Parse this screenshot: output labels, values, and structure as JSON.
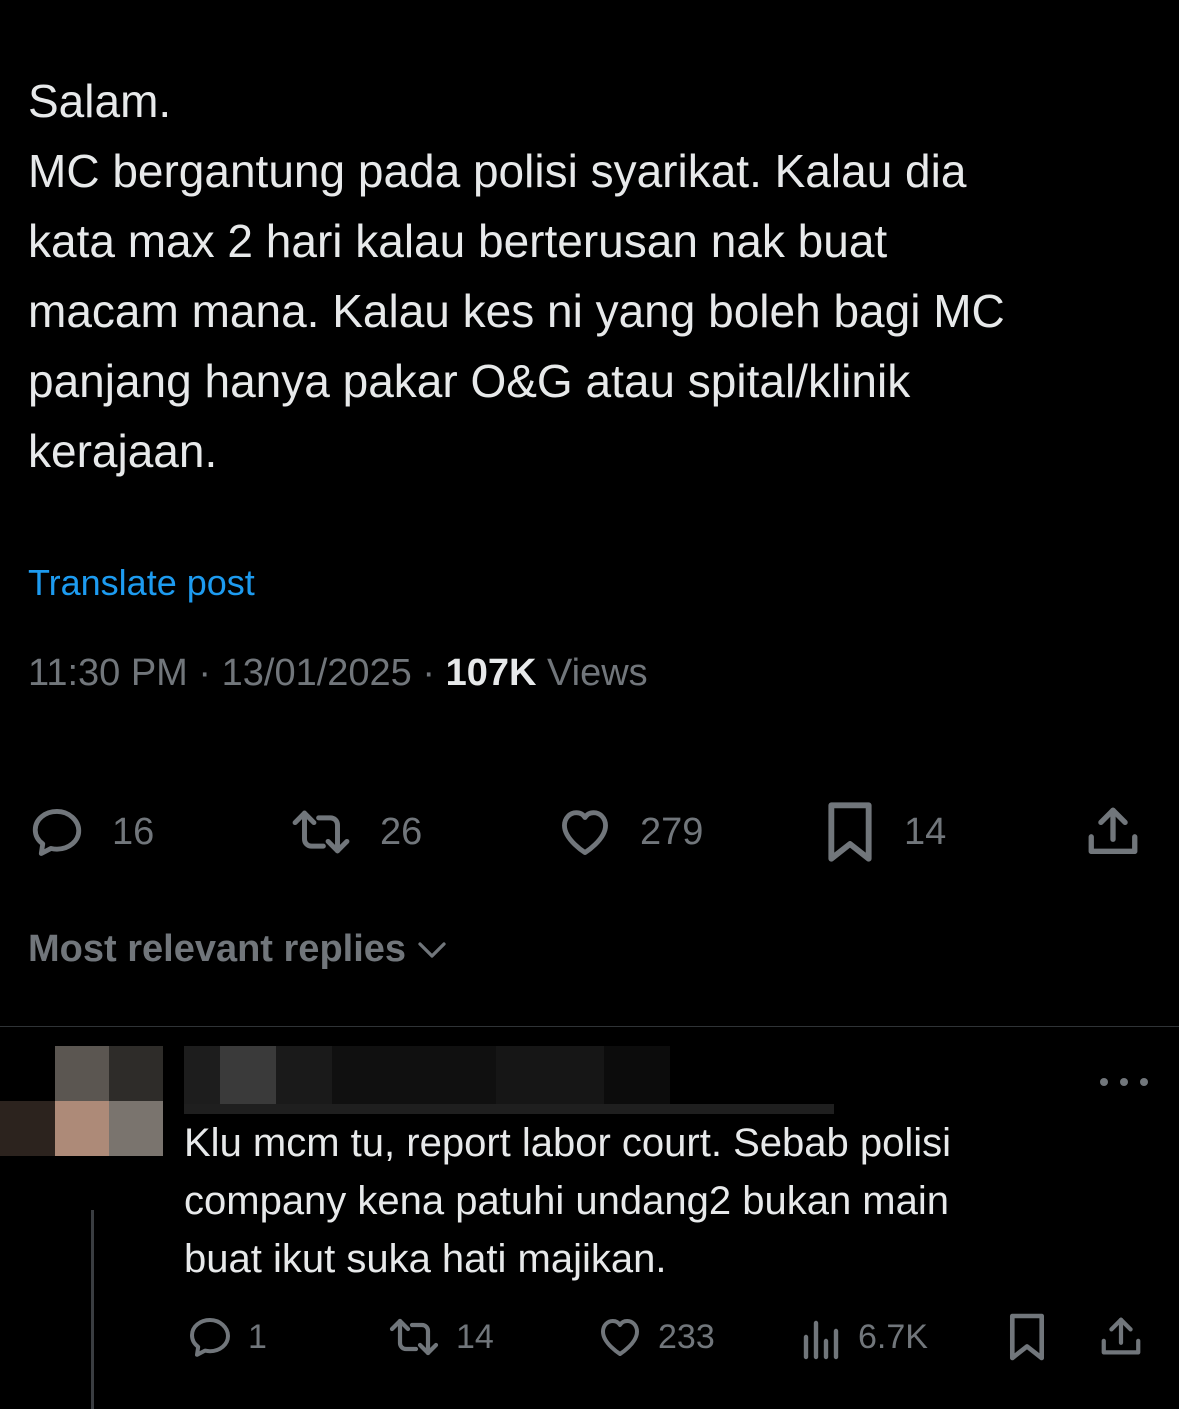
{
  "post": {
    "lines": [
      "Salam.",
      "MC bergantung pada polisi syarikat. Kalau dia",
      "kata max 2 hari kalau berterusan nak buat",
      "macam mana. Kalau kes ni yang boleh bagi MC",
      "panjang hanya pakar O&G atau spital/klinik",
      "kerajaan."
    ],
    "translate_label": "Translate post",
    "time": "11:30 PM",
    "separator": " · ",
    "date": "13/01/2025",
    "views_count": "107K",
    "views_label": "Views"
  },
  "actions": {
    "reply_count": "16",
    "repost_count": "26",
    "like_count": "279",
    "bookmark_count": "14",
    "icons": [
      "reply-icon",
      "repost-icon",
      "like-icon",
      "bookmark-icon",
      "share-icon"
    ]
  },
  "replies_sort": {
    "label": "Most relevant replies",
    "icon": "chevron-down-icon"
  },
  "reply": {
    "lines": [
      "Klu mcm tu, report labor court. Sebab polisi",
      "company kena patuhi undang2 bukan main",
      "buat ikut suka hati majikan."
    ],
    "reply_count": "1",
    "repost_count": "14",
    "like_count": "233",
    "views_count": "6.7K",
    "icons": [
      "reply-icon",
      "repost-icon",
      "like-icon",
      "views-icon",
      "bookmark-icon",
      "share-icon",
      "more-icon"
    ]
  },
  "colors": {
    "background": "#000000",
    "text_primary": "#e7e9ea",
    "text_secondary": "#71767b",
    "link": "#1d9bf0",
    "divider": "#2f3336"
  }
}
